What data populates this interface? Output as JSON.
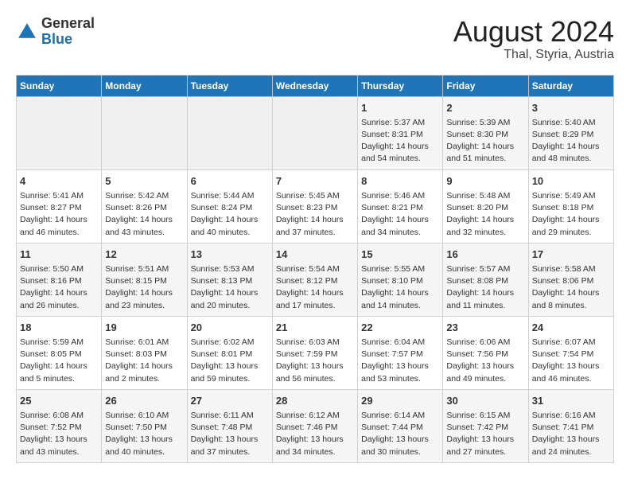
{
  "header": {
    "logo_general": "General",
    "logo_blue": "Blue",
    "month_year": "August 2024",
    "location": "Thal, Styria, Austria"
  },
  "weekdays": [
    "Sunday",
    "Monday",
    "Tuesday",
    "Wednesday",
    "Thursday",
    "Friday",
    "Saturday"
  ],
  "weeks": [
    [
      {
        "day": "",
        "info": ""
      },
      {
        "day": "",
        "info": ""
      },
      {
        "day": "",
        "info": ""
      },
      {
        "day": "",
        "info": ""
      },
      {
        "day": "1",
        "info": "Sunrise: 5:37 AM\nSunset: 8:31 PM\nDaylight: 14 hours\nand 54 minutes."
      },
      {
        "day": "2",
        "info": "Sunrise: 5:39 AM\nSunset: 8:30 PM\nDaylight: 14 hours\nand 51 minutes."
      },
      {
        "day": "3",
        "info": "Sunrise: 5:40 AM\nSunset: 8:29 PM\nDaylight: 14 hours\nand 48 minutes."
      }
    ],
    [
      {
        "day": "4",
        "info": "Sunrise: 5:41 AM\nSunset: 8:27 PM\nDaylight: 14 hours\nand 46 minutes."
      },
      {
        "day": "5",
        "info": "Sunrise: 5:42 AM\nSunset: 8:26 PM\nDaylight: 14 hours\nand 43 minutes."
      },
      {
        "day": "6",
        "info": "Sunrise: 5:44 AM\nSunset: 8:24 PM\nDaylight: 14 hours\nand 40 minutes."
      },
      {
        "day": "7",
        "info": "Sunrise: 5:45 AM\nSunset: 8:23 PM\nDaylight: 14 hours\nand 37 minutes."
      },
      {
        "day": "8",
        "info": "Sunrise: 5:46 AM\nSunset: 8:21 PM\nDaylight: 14 hours\nand 34 minutes."
      },
      {
        "day": "9",
        "info": "Sunrise: 5:48 AM\nSunset: 8:20 PM\nDaylight: 14 hours\nand 32 minutes."
      },
      {
        "day": "10",
        "info": "Sunrise: 5:49 AM\nSunset: 8:18 PM\nDaylight: 14 hours\nand 29 minutes."
      }
    ],
    [
      {
        "day": "11",
        "info": "Sunrise: 5:50 AM\nSunset: 8:16 PM\nDaylight: 14 hours\nand 26 minutes."
      },
      {
        "day": "12",
        "info": "Sunrise: 5:51 AM\nSunset: 8:15 PM\nDaylight: 14 hours\nand 23 minutes."
      },
      {
        "day": "13",
        "info": "Sunrise: 5:53 AM\nSunset: 8:13 PM\nDaylight: 14 hours\nand 20 minutes."
      },
      {
        "day": "14",
        "info": "Sunrise: 5:54 AM\nSunset: 8:12 PM\nDaylight: 14 hours\nand 17 minutes."
      },
      {
        "day": "15",
        "info": "Sunrise: 5:55 AM\nSunset: 8:10 PM\nDaylight: 14 hours\nand 14 minutes."
      },
      {
        "day": "16",
        "info": "Sunrise: 5:57 AM\nSunset: 8:08 PM\nDaylight: 14 hours\nand 11 minutes."
      },
      {
        "day": "17",
        "info": "Sunrise: 5:58 AM\nSunset: 8:06 PM\nDaylight: 14 hours\nand 8 minutes."
      }
    ],
    [
      {
        "day": "18",
        "info": "Sunrise: 5:59 AM\nSunset: 8:05 PM\nDaylight: 14 hours\nand 5 minutes."
      },
      {
        "day": "19",
        "info": "Sunrise: 6:01 AM\nSunset: 8:03 PM\nDaylight: 14 hours\nand 2 minutes."
      },
      {
        "day": "20",
        "info": "Sunrise: 6:02 AM\nSunset: 8:01 PM\nDaylight: 13 hours\nand 59 minutes."
      },
      {
        "day": "21",
        "info": "Sunrise: 6:03 AM\nSunset: 7:59 PM\nDaylight: 13 hours\nand 56 minutes."
      },
      {
        "day": "22",
        "info": "Sunrise: 6:04 AM\nSunset: 7:57 PM\nDaylight: 13 hours\nand 53 minutes."
      },
      {
        "day": "23",
        "info": "Sunrise: 6:06 AM\nSunset: 7:56 PM\nDaylight: 13 hours\nand 49 minutes."
      },
      {
        "day": "24",
        "info": "Sunrise: 6:07 AM\nSunset: 7:54 PM\nDaylight: 13 hours\nand 46 minutes."
      }
    ],
    [
      {
        "day": "25",
        "info": "Sunrise: 6:08 AM\nSunset: 7:52 PM\nDaylight: 13 hours\nand 43 minutes."
      },
      {
        "day": "26",
        "info": "Sunrise: 6:10 AM\nSunset: 7:50 PM\nDaylight: 13 hours\nand 40 minutes."
      },
      {
        "day": "27",
        "info": "Sunrise: 6:11 AM\nSunset: 7:48 PM\nDaylight: 13 hours\nand 37 minutes."
      },
      {
        "day": "28",
        "info": "Sunrise: 6:12 AM\nSunset: 7:46 PM\nDaylight: 13 hours\nand 34 minutes."
      },
      {
        "day": "29",
        "info": "Sunrise: 6:14 AM\nSunset: 7:44 PM\nDaylight: 13 hours\nand 30 minutes."
      },
      {
        "day": "30",
        "info": "Sunrise: 6:15 AM\nSunset: 7:42 PM\nDaylight: 13 hours\nand 27 minutes."
      },
      {
        "day": "31",
        "info": "Sunrise: 6:16 AM\nSunset: 7:41 PM\nDaylight: 13 hours\nand 24 minutes."
      }
    ]
  ]
}
